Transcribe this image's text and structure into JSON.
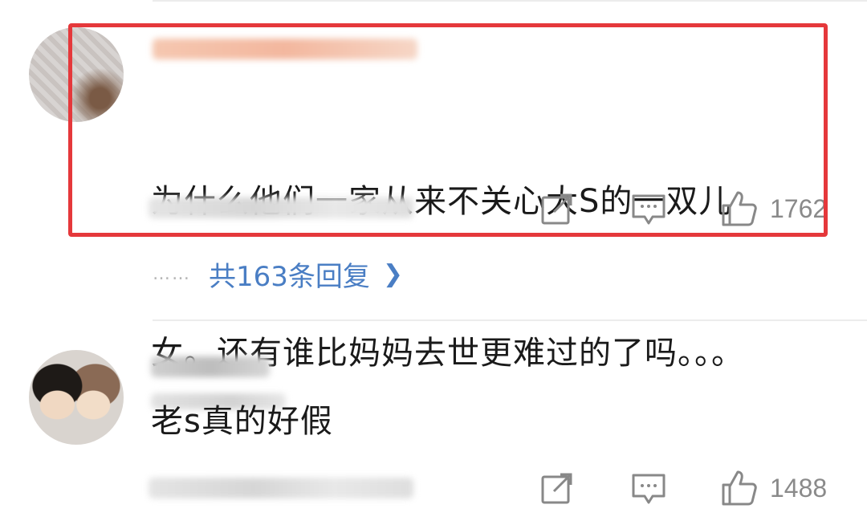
{
  "comments": [
    {
      "text_line1": "为什么他们一家从来不关心大S的一双儿",
      "text_line2": "女。还有谁比妈妈去世更难过的了吗。。。",
      "likes": "1762",
      "icons": [
        "share-icon",
        "comment-icon",
        "like-icon"
      ],
      "replies_label": "共163条回复",
      "replies_dots": "……"
    },
    {
      "text": "老s真的好假",
      "likes": "1488",
      "icons": [
        "share-icon",
        "comment-icon",
        "like-icon"
      ]
    }
  ],
  "colors": {
    "highlight": "#e5383b",
    "link": "#4a7ec4",
    "muted": "#8a8a8a"
  }
}
